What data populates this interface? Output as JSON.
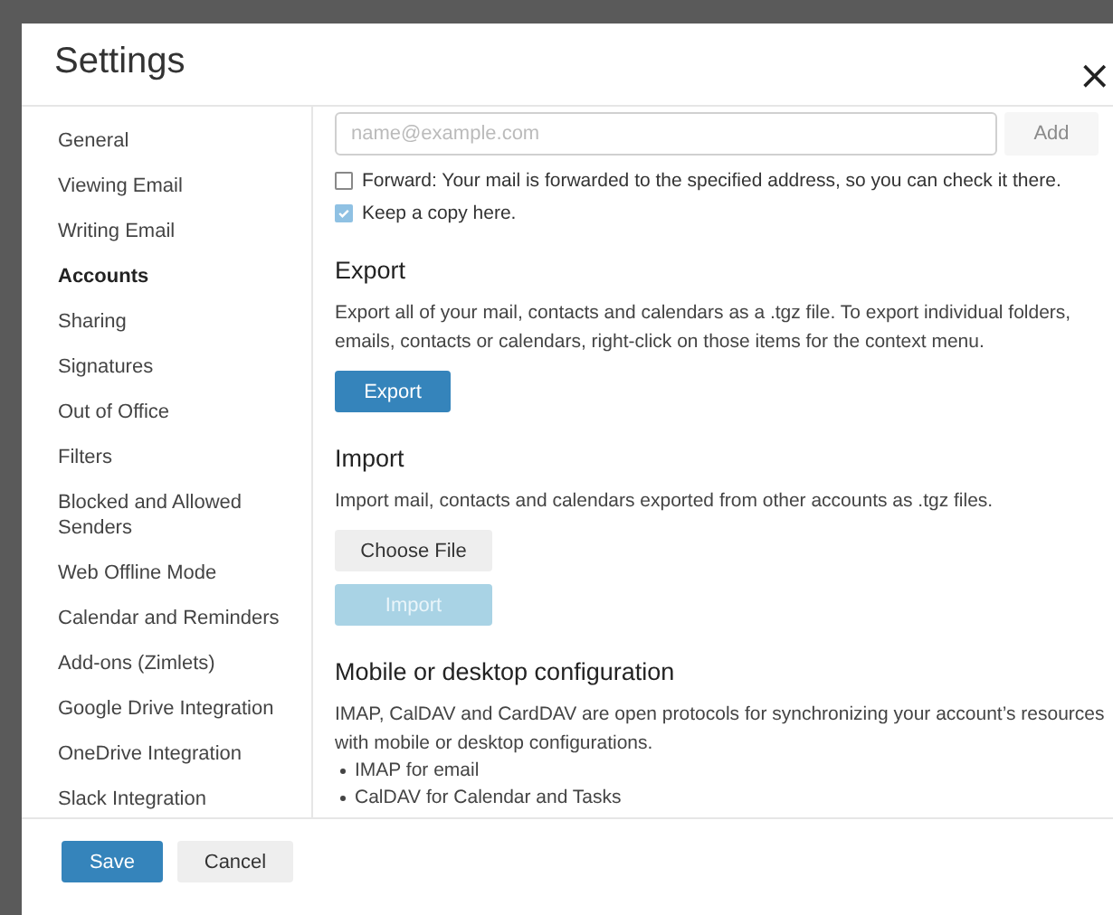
{
  "dialog": {
    "title": "Settings",
    "close": "×"
  },
  "sidebar": {
    "items": [
      {
        "label": "General",
        "selected": false
      },
      {
        "label": "Viewing Email",
        "selected": false
      },
      {
        "label": "Writing Email",
        "selected": false
      },
      {
        "label": "Accounts",
        "selected": true
      },
      {
        "label": "Sharing",
        "selected": false
      },
      {
        "label": "Signatures",
        "selected": false
      },
      {
        "label": "Out of Office",
        "selected": false
      },
      {
        "label": "Filters",
        "selected": false
      },
      {
        "label": "Blocked and Allowed Senders",
        "selected": false
      },
      {
        "label": "Web Offline Mode",
        "selected": false
      },
      {
        "label": "Calendar and Reminders",
        "selected": false
      },
      {
        "label": "Add-ons (Zimlets)",
        "selected": false
      },
      {
        "label": "Google Drive Integration",
        "selected": false
      },
      {
        "label": "OneDrive Integration",
        "selected": false
      },
      {
        "label": "Slack Integration",
        "selected": false
      }
    ]
  },
  "forwarding": {
    "address": {
      "placeholder": "name@example.com"
    },
    "add_button": {
      "label": "Add",
      "disabled": true
    },
    "options": [
      {
        "label": "Forward: Your mail is forwarded to the specified address, so you can check it there.",
        "checked": false
      },
      {
        "label": "Keep a copy here.",
        "checked": true
      }
    ]
  },
  "sections": [
    {
      "heading": "Export",
      "text": "Export all of your mail, contacts and calendars as a .tgz file. To export individual folders, emails, contacts or calendars, right-click on those items for the context menu.",
      "buttons": [
        {
          "label": "Export",
          "kind": "primary",
          "disabled": false
        }
      ]
    },
    {
      "heading": "Import",
      "text": "Import mail, contacts and calendars exported from other accounts as .tgz files.",
      "buttons": [
        {
          "label": "Choose File",
          "kind": "secondary",
          "disabled": false
        },
        {
          "label": "Import",
          "kind": "primary",
          "disabled": true
        }
      ]
    },
    {
      "heading": "Mobile or desktop configuration",
      "text": "IMAP, CalDAV and CardDAV are open protocols for synchronizing your account’s resources with mobile or desktop configurations.",
      "bullets": [
        "IMAP for email",
        "CalDAV for Calendar and Tasks"
      ]
    }
  ],
  "footer": {
    "buttons": [
      {
        "label": "Save",
        "kind": "primary",
        "disabled": false
      },
      {
        "label": "Cancel",
        "kind": "secondary",
        "disabled": false
      }
    ]
  }
}
